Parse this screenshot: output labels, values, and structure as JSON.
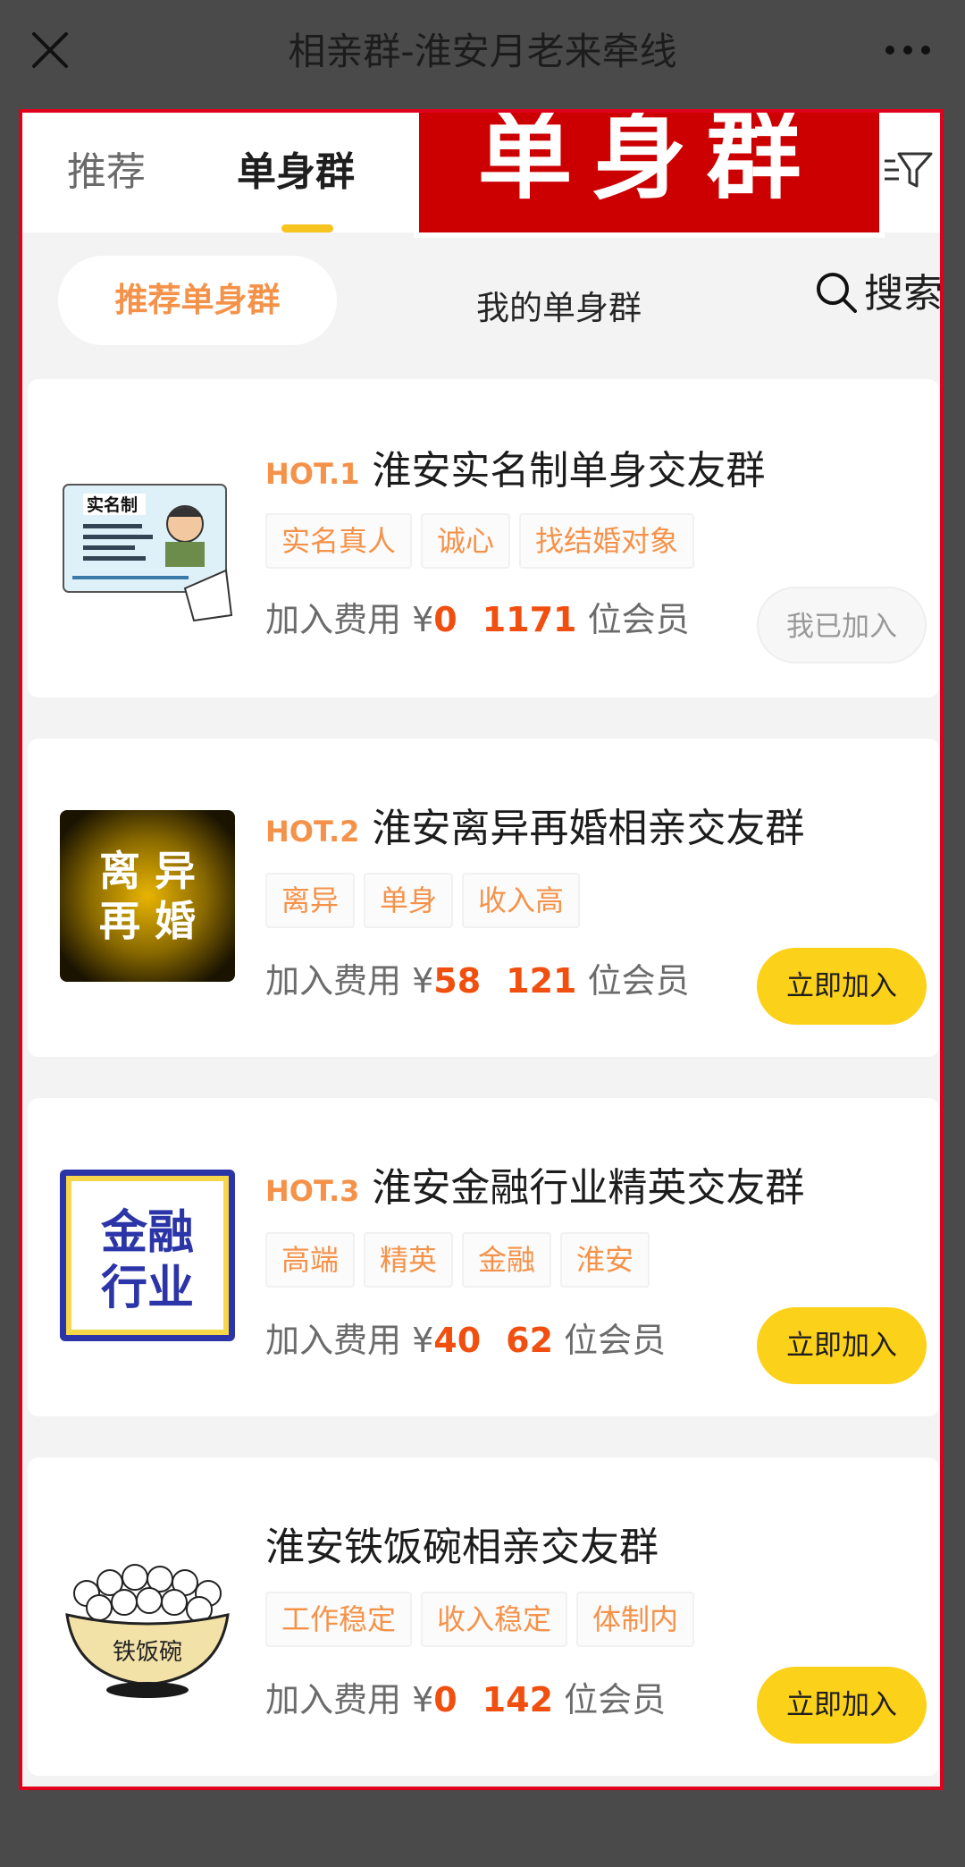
{
  "header": {
    "title": "相亲群-淮安月老来牵线"
  },
  "tabs": [
    {
      "label": "推荐",
      "active": false
    },
    {
      "label": "单身群",
      "active": true
    }
  ],
  "banner": {
    "text": "单身群"
  },
  "subtabs": {
    "recommended": "推荐单身群",
    "mine": "我的单身群",
    "search": "搜索"
  },
  "labels": {
    "fee_prefix": "加入费用 ¥",
    "members_suffix": "位会员"
  },
  "groups": [
    {
      "hot": "HOT.1",
      "name": "淮安实名制单身交友群",
      "tags": [
        "实名真人",
        "诚心",
        "找结婚对象"
      ],
      "fee": "0",
      "members": "1171",
      "button": "我已加入",
      "joined": true,
      "thumb_text": "实名制"
    },
    {
      "hot": "HOT.2",
      "name": "淮安离异再婚相亲交友群",
      "tags": [
        "离异",
        "单身",
        "收入高"
      ],
      "fee": "58",
      "members": "121",
      "button": "立即加入",
      "joined": false,
      "thumb_text": [
        "离 异",
        "再 婚"
      ]
    },
    {
      "hot": "HOT.3",
      "name": "淮安金融行业精英交友群",
      "tags": [
        "高端",
        "精英",
        "金融",
        "淮安"
      ],
      "fee": "40",
      "members": "62",
      "button": "立即加入",
      "joined": false,
      "thumb_text": [
        "金融",
        "行业"
      ]
    },
    {
      "hot": "",
      "name": "淮安铁饭碗相亲交友群",
      "tags": [
        "工作稳定",
        "收入稳定",
        "体制内"
      ],
      "fee": "0",
      "members": "142",
      "button": "立即加入",
      "joined": false,
      "thumb_text": "铁饭碗"
    }
  ],
  "colors": {
    "accent_orange": "#f5924a",
    "number_red": "#f04f10",
    "button_yellow": "#fcd119",
    "frame_red": "#e0001b"
  }
}
